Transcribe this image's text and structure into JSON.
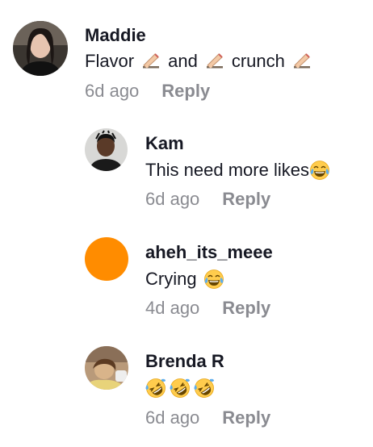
{
  "comments": [
    {
      "author": "Maddie",
      "parts": [
        "Flavor",
        "writing-hand-icon",
        "and",
        "writing-hand-icon",
        "crunch",
        "writing-hand-icon"
      ],
      "time": "6d ago",
      "reply_label": "Reply",
      "avatar": "avatar-photo-maddie"
    },
    {
      "author": "Kam",
      "text": "This need more likes",
      "emoji": "tears-of-joy-icon",
      "time": "6d ago",
      "reply_label": "Reply",
      "avatar": "avatar-photo-kam"
    },
    {
      "author": "aheh_its_meee",
      "text": "Crying",
      "emoji": "tears-of-joy-icon",
      "time": "4d ago",
      "reply_label": "Reply",
      "avatar_color": "#ff8c00"
    },
    {
      "author": "Brenda R",
      "emojis": [
        "rofl-icon",
        "rofl-icon",
        "rofl-icon"
      ],
      "time": "6d ago",
      "reply_label": "Reply",
      "avatar": "avatar-photo-brenda"
    }
  ],
  "colors": {
    "primary_text": "#161823",
    "secondary_text": "#8a8b91",
    "avatar_orange": "#ff8c00"
  }
}
